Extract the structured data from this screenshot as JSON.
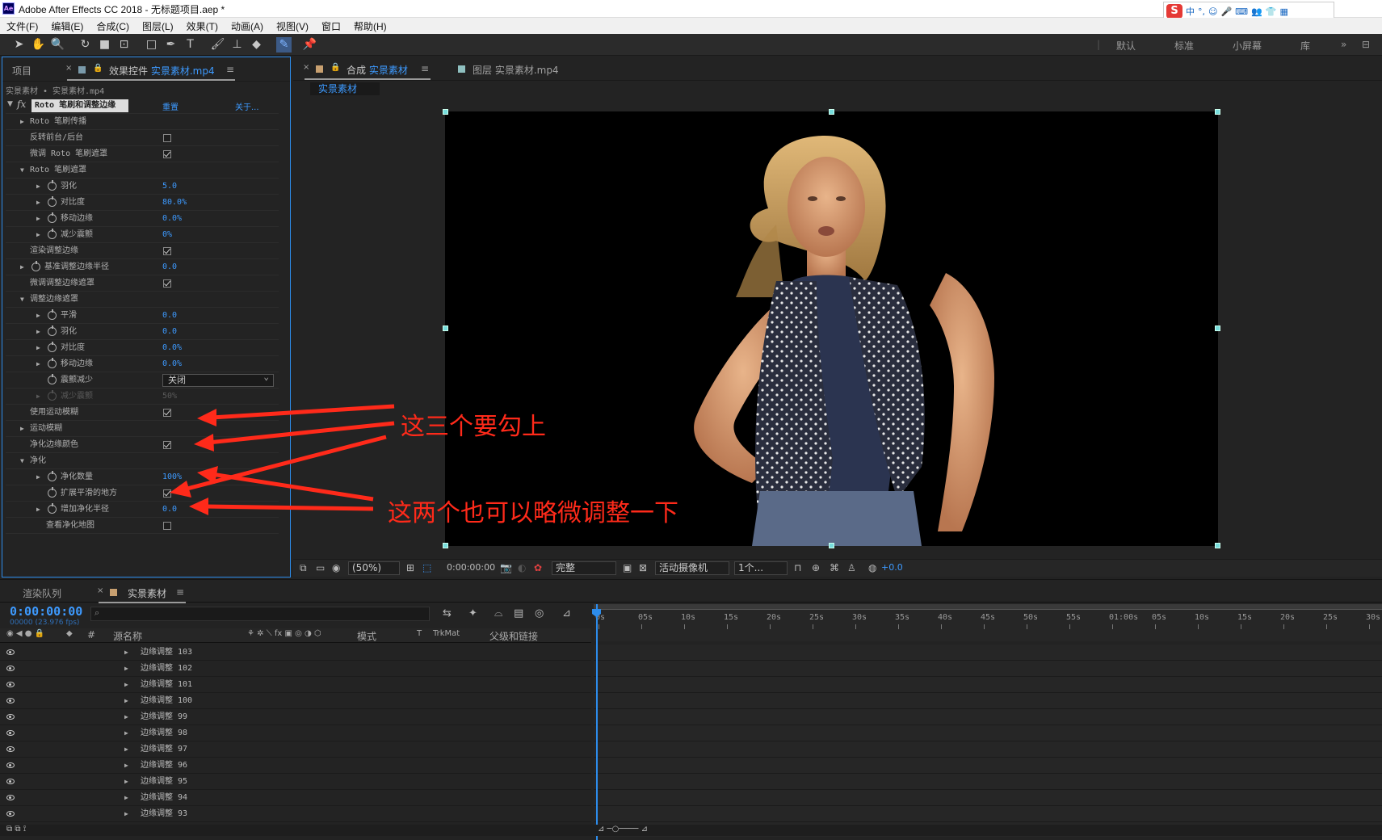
{
  "window": {
    "title": "Adobe After Effects CC 2018 - 无标题项目.aep *",
    "logo": "Ae"
  },
  "ime": {
    "lang": "中",
    "punct": "°,"
  },
  "menu": [
    "文件(F)",
    "编辑(E)",
    "合成(C)",
    "图层(L)",
    "效果(T)",
    "动画(A)",
    "视图(V)",
    "窗口",
    "帮助(H)"
  ],
  "workspaces": [
    "默认",
    "标准",
    "小屏幕",
    "库"
  ],
  "left_panel": {
    "tab_project": "项目",
    "tab_effects_prefix": "效果控件",
    "tab_effects_name": "实景素材.mp4",
    "breadcrumb": "实景素材 • 实景素材.mp4",
    "effect": {
      "name": "Roto 笔刷和调整边缘",
      "reset": "重置",
      "about": "关于..."
    },
    "props": [
      {
        "label": "Roto 笔刷传播",
        "indent": 1,
        "arrow": "right"
      },
      {
        "label": "反转前台/后台",
        "indent": 1,
        "check": false
      },
      {
        "label": "微调 Roto 笔刷遮罩",
        "indent": 1,
        "check": true
      },
      {
        "label": "Roto 笔刷遮罩",
        "indent": 1,
        "arrow": "down"
      },
      {
        "label": "羽化",
        "indent": 2,
        "arrow": "right",
        "stopwatch": true,
        "value": "5.0"
      },
      {
        "label": "对比度",
        "indent": 2,
        "arrow": "right",
        "stopwatch": true,
        "value": "80.0%"
      },
      {
        "label": "移动边缘",
        "indent": 2,
        "arrow": "right",
        "stopwatch": true,
        "value": "0.0%"
      },
      {
        "label": "减少震颤",
        "indent": 2,
        "arrow": "right",
        "stopwatch": true,
        "value": "0%"
      },
      {
        "label": "渲染调整边缘",
        "indent": 1,
        "check": true
      },
      {
        "label": "基准调整边缘半径",
        "indent": 1,
        "arrow": "right",
        "stopwatch": true,
        "value": "0.0"
      },
      {
        "label": "微调调整边缘遮罩",
        "indent": 1,
        "check": true
      },
      {
        "label": "调整边缘遮罩",
        "indent": 1,
        "arrow": "down"
      },
      {
        "label": "平滑",
        "indent": 2,
        "arrow": "right",
        "stopwatch": true,
        "value": "0.0"
      },
      {
        "label": "羽化",
        "indent": 2,
        "arrow": "right",
        "stopwatch": true,
        "value": "0.0"
      },
      {
        "label": "对比度",
        "indent": 2,
        "arrow": "right",
        "stopwatch": true,
        "value": "0.0%"
      },
      {
        "label": "移动边缘",
        "indent": 2,
        "arrow": "right",
        "stopwatch": true,
        "value": "0.0%"
      },
      {
        "label": "震颤减少",
        "indent": 2,
        "stopwatch": true,
        "dropdown": "关闭"
      },
      {
        "label": "减少震颤",
        "indent": 2,
        "arrow": "right",
        "stopwatch": true,
        "value": "50%",
        "disabled": true
      },
      {
        "label": "使用运动模糊",
        "indent": 1,
        "check": true
      },
      {
        "label": "运动模糊",
        "indent": 1,
        "arrow": "right"
      },
      {
        "label": "净化边缘颜色",
        "indent": 1,
        "check": true
      },
      {
        "label": "净化",
        "indent": 1,
        "arrow": "down"
      },
      {
        "label": "净化数量",
        "indent": 2,
        "arrow": "right",
        "stopwatch": true,
        "value": "100%"
      },
      {
        "label": "扩展平滑的地方",
        "indent": 2,
        "stopwatch": true,
        "check": true
      },
      {
        "label": "增加净化半径",
        "indent": 2,
        "arrow": "right",
        "stopwatch": true,
        "value": "0.0"
      },
      {
        "label": "查看净化地图",
        "indent": 2,
        "check": false
      }
    ]
  },
  "comp_panel": {
    "tab_comp_prefix": "合成",
    "tab_comp_name": "实景素材",
    "tab_layer": "图层 实景素材.mp4",
    "breadcrumb": "实景素材",
    "bar": {
      "zoom": "(50%)",
      "time": "0:00:00:00",
      "quality": "完整",
      "camera": "活动摄像机",
      "views": "1个...",
      "exposure": "+0.0"
    }
  },
  "timeline": {
    "tab_render": "渲染队列",
    "tab_comp": "实景素材",
    "timecode": "0:00:00:00",
    "fps": "00000 (23.976 fps)",
    "columns": {
      "num": "#",
      "source": "源名称",
      "mode": "模式",
      "t": "T",
      "trkmat": "TrkMat",
      "parent": "父级和链接"
    },
    "ticks": [
      "0s",
      "05s",
      "10s",
      "15s",
      "20s",
      "25s",
      "30s",
      "35s",
      "40s",
      "45s",
      "50s",
      "55s",
      "01:00s",
      "05s",
      "10s",
      "15s",
      "20s",
      "25s",
      "30s"
    ],
    "layers": [
      "边缘调整 103",
      "边缘调整 102",
      "边缘调整 101",
      "边缘调整 100",
      "边缘调整 99",
      "边缘调整 98",
      "边缘调整 97",
      "边缘调整 96",
      "边缘调整 95",
      "边缘调整 94",
      "边缘调整 93"
    ]
  },
  "annotations": {
    "note1": "这三个要勾上",
    "note2": "这两个也可以略微调整一下",
    "color": "#ff2a1a"
  }
}
